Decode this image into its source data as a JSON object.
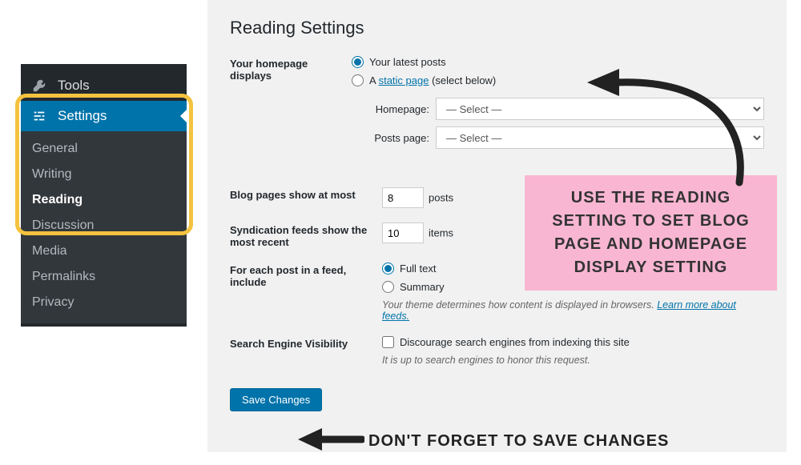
{
  "sidebar": {
    "tools": {
      "label": "Tools"
    },
    "settings": {
      "label": "Settings"
    },
    "sub": {
      "general": "General",
      "writing": "Writing",
      "reading": "Reading",
      "discussion": "Discussion",
      "media": "Media",
      "permalinks": "Permalinks",
      "privacy": "Privacy"
    }
  },
  "panel": {
    "title": "Reading Settings",
    "homepage_displays": {
      "label": "Your homepage displays",
      "opt_latest": "Your latest posts",
      "opt_static_prefix": "A ",
      "opt_static_link": "static page",
      "opt_static_suffix": " (select below)",
      "homepage_label": "Homepage:",
      "postspage_label": "Posts page:",
      "select_placeholder": "— Select —"
    },
    "blog_pages": {
      "label": "Blog pages show at most",
      "value": "8",
      "unit": "posts"
    },
    "syndication": {
      "label": "Syndication feeds show the most recent",
      "value": "10",
      "unit": "items"
    },
    "feed_content": {
      "label": "For each post in a feed, include",
      "opt_full": "Full text",
      "opt_summary": "Summary",
      "hint_prefix": "Your theme determines how content is displayed in browsers. ",
      "hint_link": "Learn more about feeds."
    },
    "search_visibility": {
      "label": "Search Engine Visibility",
      "checkbox_label": "Discourage search engines from indexing this site",
      "hint": "It is up to search engines to honor this request."
    },
    "save_button": "Save Changes"
  },
  "callouts": {
    "pink_box": "USE THE READING SETTING TO SET BLOG PAGE AND HOMEPAGE DISPLAY SETTING",
    "save_note": "DON'T FORGET TO SAVE CHANGES"
  }
}
